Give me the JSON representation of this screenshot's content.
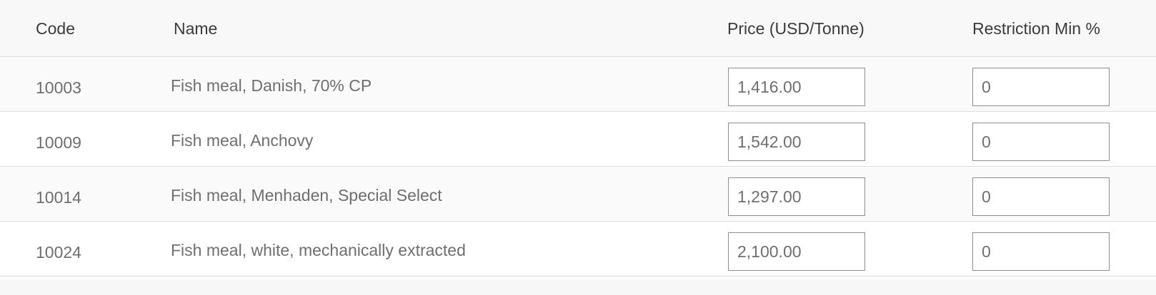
{
  "table": {
    "columns": {
      "code": "Code",
      "name": "Name",
      "price": "Price (USD/Tonne)",
      "restriction_min": "Restriction Min %"
    },
    "rows": [
      {
        "code": "10003",
        "name": "Fish meal, Danish, 70% CP",
        "price": "1,416.00",
        "restriction_min": "0"
      },
      {
        "code": "10009",
        "name": "Fish meal, Anchovy",
        "price": "1,542.00",
        "restriction_min": "0"
      },
      {
        "code": "10014",
        "name": "Fish meal, Menhaden, Special Select",
        "price": "1,297.00",
        "restriction_min": "0"
      },
      {
        "code": "10024",
        "name": "Fish meal, white, mechanically extracted",
        "price": "2,100.00",
        "restriction_min": "0"
      }
    ]
  }
}
